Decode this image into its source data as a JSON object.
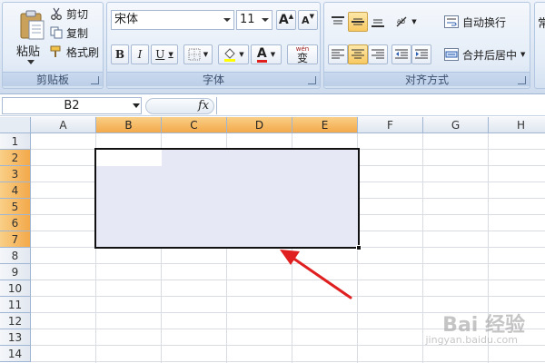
{
  "ribbon": {
    "clipboard": {
      "paste_label": "粘贴",
      "cut_label": "剪切",
      "copy_label": "复制",
      "format_painter_label": "格式刷",
      "group_label": "剪贴板"
    },
    "font": {
      "font_name": "宋体",
      "font_size": "11",
      "bold": "B",
      "italic": "I",
      "underline": "U",
      "font_color_glyph": "A",
      "phonetic_glyph": "变",
      "phonetic_top": "wén",
      "grow_glyph": "A",
      "shrink_glyph": "A",
      "group_label": "字体",
      "font_color": "#e0201c",
      "fill_color": "#ffff00"
    },
    "alignment": {
      "wrap_text_label": "自动换行",
      "merge_center_label": "合并后居中",
      "group_label": "对齐方式"
    },
    "number": {
      "format_partial": "常"
    }
  },
  "formula_bar": {
    "name_box": "B2",
    "fx_label": "fx",
    "formula": ""
  },
  "columns": [
    "A",
    "B",
    "C",
    "D",
    "E",
    "F",
    "G",
    "H"
  ],
  "selected_columns": [
    "B",
    "C",
    "D",
    "E"
  ],
  "rows": [
    "1",
    "2",
    "3",
    "4",
    "5",
    "6",
    "7",
    "8",
    "9",
    "10",
    "11",
    "12",
    "13",
    "14"
  ],
  "selected_rows": [
    "2",
    "3",
    "4",
    "5",
    "6",
    "7"
  ],
  "selection": {
    "range": "B2:E7",
    "active_cell": "B2"
  },
  "annotation": {
    "arrow_color": "#e02020"
  },
  "watermark": {
    "text": "Bai 经验",
    "sub": "jingyan.baidu.com"
  }
}
